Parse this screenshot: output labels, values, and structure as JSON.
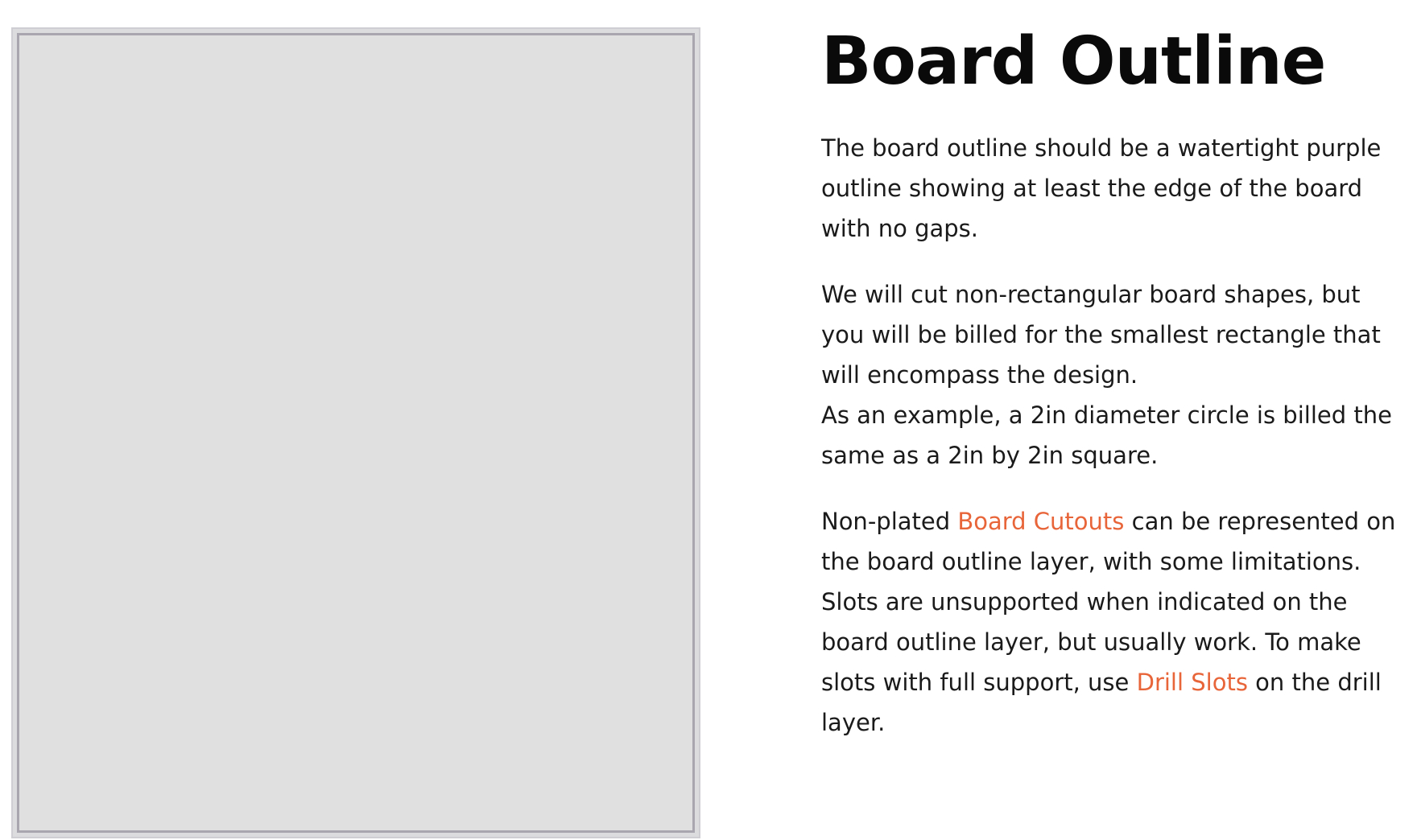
{
  "title": "Board Outline",
  "paragraphs": {
    "p1": "The board outline should be a watertight purple outline showing at least the edge of the board with no gaps.",
    "p2_line1": "We will cut non-rectangular board shapes, but you will be billed for the smallest rectangle that will encompass the design.",
    "p2_line2": "As an example, a 2in diameter circle is billed the same as a 2in by 2in square.",
    "p3_before_link1": "Non-plated ",
    "p3_link1": "Board Cutouts",
    "p3_between": " can be represented on the board outline layer, with some limitations. Slots are unsupported when indicated on the board outline layer, but usually work. To make slots with full support, use ",
    "p3_link2": "Drill Slots",
    "p3_after": " on the drill layer."
  },
  "colors": {
    "link": "#e8653a",
    "outline": "#a9a6b0",
    "board_fill": "#e0e0e0"
  }
}
